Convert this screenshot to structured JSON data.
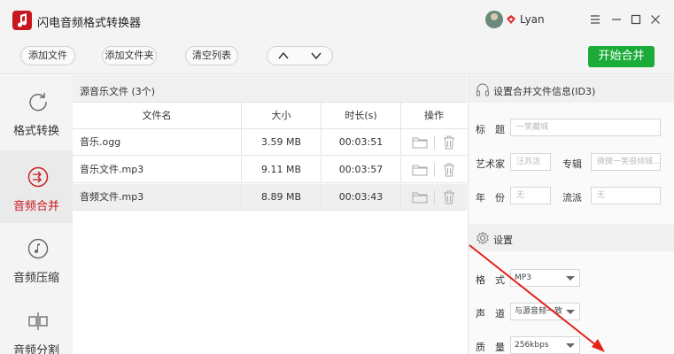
{
  "app": {
    "title": "闪电音频格式转换器",
    "user": "Lyan"
  },
  "toolbar": {
    "add_file": "添加文件",
    "add_folder": "添加文件夹",
    "clear_list": "清空列表",
    "start_merge": "开始合并"
  },
  "sidebar": {
    "items": [
      {
        "label": "格式转换",
        "icon": "refresh-icon",
        "active": false
      },
      {
        "label": "音频合并",
        "icon": "merge-icon",
        "active": true
      },
      {
        "label": "音频压缩",
        "icon": "note-icon",
        "active": false
      },
      {
        "label": "音频分割",
        "icon": "split-icon",
        "active": false
      }
    ]
  },
  "files": {
    "header": "源音乐文件 (3个)",
    "columns": [
      "文件名",
      "大小",
      "时长(s)",
      "操作"
    ],
    "rows": [
      {
        "name": "音乐.ogg",
        "size": "3.59 MB",
        "duration": "00:03:51"
      },
      {
        "name": "音乐文件.mp3",
        "size": "9.11 MB",
        "duration": "00:03:57"
      },
      {
        "name": "音频文件.mp3",
        "size": "8.89 MB",
        "duration": "00:03:43"
      }
    ]
  },
  "id3": {
    "header": "设置合并文件信息(ID3)",
    "title_label": "标　题",
    "title_placeholder": "一笑藏城",
    "artist_label": "艺术家",
    "artist_placeholder": "汪苏泷",
    "album_label": "专辑",
    "album_placeholder": "微微一笑很倾城...",
    "year_label": "年　份",
    "year_placeholder": "无",
    "genre_label": "流派",
    "genre_placeholder": "无"
  },
  "settings": {
    "header": "设置",
    "format_label": "格　式",
    "format_value": "MP3",
    "channel_label": "声　道",
    "channel_value": "与源音频一致",
    "quality_label": "质　量",
    "quality_value": "256kbps"
  },
  "colors": {
    "accent_red": "#c8161d",
    "start_green": "#1aab39"
  }
}
